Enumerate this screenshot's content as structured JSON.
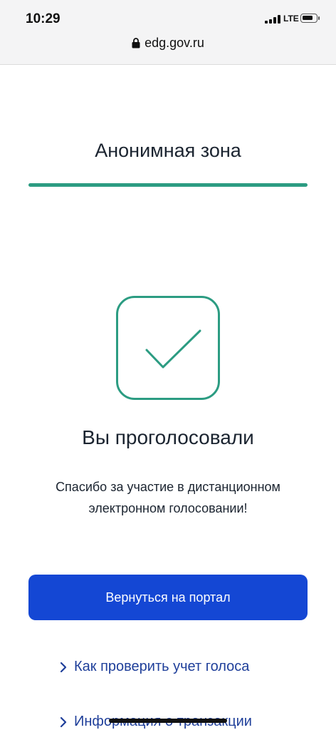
{
  "status_bar": {
    "time": "10:29",
    "network": "LTE",
    "battery_level": 0.8
  },
  "browser": {
    "url": "edg.gov.ru",
    "lock_icon": "lock-icon"
  },
  "page": {
    "title": "Анонимная зона",
    "progress": 1.0,
    "accent_color": "#2c9c82"
  },
  "result": {
    "icon": "checkmark-icon",
    "heading": "Вы проголосовали",
    "message_line1": "Спасибо за участие в дистанционном",
    "message_line2": "электронном голосовании!"
  },
  "actions": {
    "return_button": "Вернуться на портал",
    "button_color": "#1447d4",
    "links": [
      {
        "label": "Как проверить учет голоса",
        "icon": "chevron-right-icon"
      },
      {
        "label": "Информация о транзакции",
        "icon": "chevron-right-icon"
      }
    ]
  }
}
